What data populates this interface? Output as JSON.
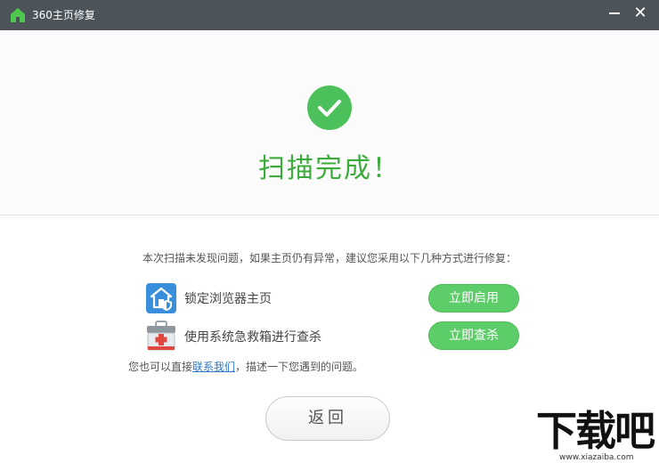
{
  "window": {
    "title": "360主页修复",
    "icon": "house-icon"
  },
  "result": {
    "title": "扫描完成！",
    "icon": "checkmark-circle-icon"
  },
  "description": "本次扫描未发现问题，如果主页仍有异常，建议您采用以下几种方式进行修复：",
  "options": [
    {
      "label": "锁定浏览器主页",
      "button": "立即启用",
      "icon": "browser-lock-icon"
    },
    {
      "label": "使用系统急救箱进行查杀",
      "button": "立即查杀",
      "icon": "first-aid-kit-icon"
    }
  ],
  "contact": {
    "prefix": "您也可以直接",
    "link": "联系我们",
    "suffix": "，描述一下您遇到的问题。"
  },
  "back_button": "返回",
  "watermark": {
    "text": "下载吧",
    "url": "www.xiazaiba.com"
  },
  "colors": {
    "titlebar": "#4c545a",
    "success_green": "#3dac3d",
    "button_green": "#5dcd6a",
    "link_blue": "#2b78c5"
  }
}
